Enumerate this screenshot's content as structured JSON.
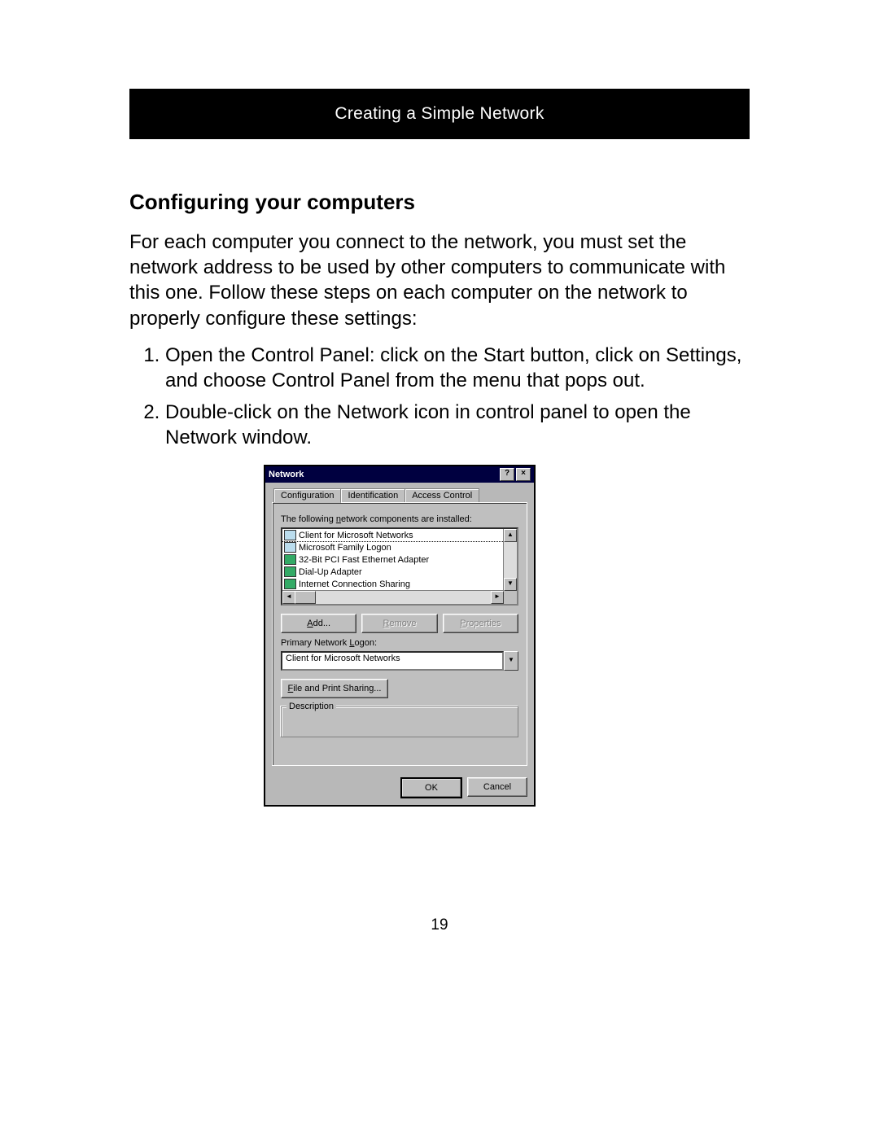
{
  "header": {
    "title": "Creating a Simple Network"
  },
  "section": {
    "title": "Configuring your computers"
  },
  "intro": "For each computer you connect to the network, you must set the network address to be used by other computers to communicate with this one. Follow these steps on each computer on the network to properly configure these settings:",
  "steps": [
    "Open the Control Panel: click on the Start button, click on Settings, and choose Control Panel from the menu that pops out.",
    "Double-click on the Network icon in control panel to open the Network window."
  ],
  "page_number": "19",
  "dialog": {
    "title": "Network",
    "help_btn": "?",
    "close_btn": "×",
    "tabs": {
      "configuration": "Configuration",
      "identification": "Identification",
      "access_control": "Access Control"
    },
    "components_label_pre": "The following ",
    "components_label_ul": "n",
    "components_label_post": "etwork components are installed:",
    "components": [
      "Client for Microsoft Networks",
      "Microsoft Family Logon",
      "32-Bit PCI Fast Ethernet Adapter",
      "Dial-Up Adapter",
      "Internet Connection Sharing"
    ],
    "buttons": {
      "add_ul": "A",
      "add_rest": "dd...",
      "remove_ul": "R",
      "remove_rest": "emove",
      "properties_ul": "P",
      "properties_rest": "roperties"
    },
    "primary_logon_label_pre": "Primary Network ",
    "primary_logon_label_ul": "L",
    "primary_logon_label_post": "ogon:",
    "primary_logon_value": "Client for Microsoft Networks",
    "file_print_ul": "F",
    "file_print_rest": "ile and Print Sharing...",
    "description_label": "Description",
    "ok": "OK",
    "cancel": "Cancel"
  }
}
